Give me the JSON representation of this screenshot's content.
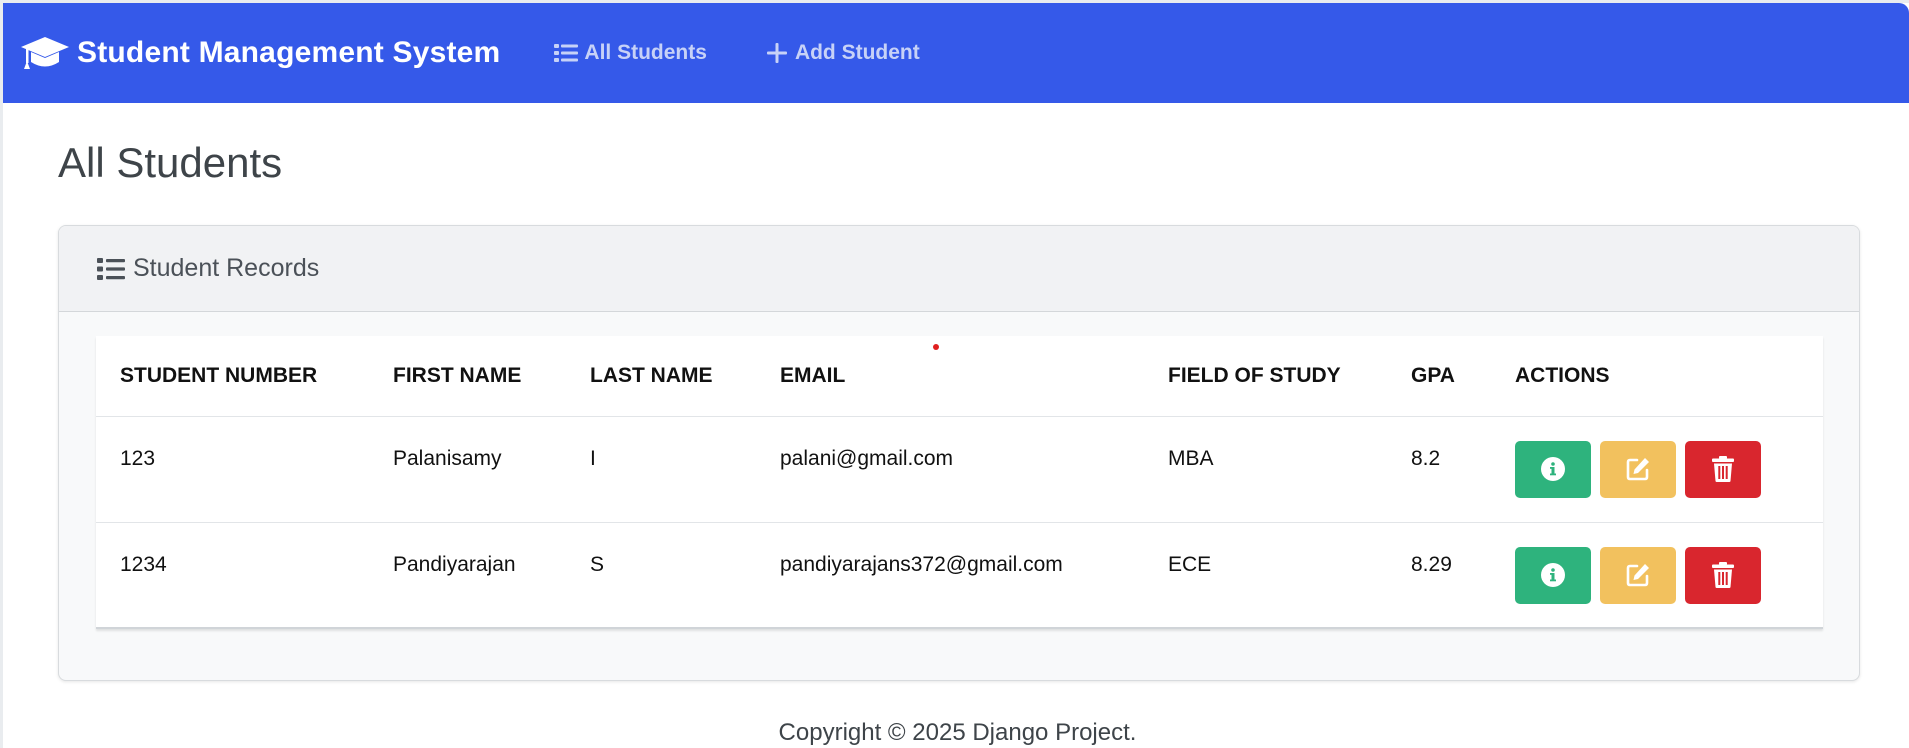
{
  "navbar": {
    "brand_icon": "graduation-cap-icon",
    "brand": "Student Management System",
    "links": [
      {
        "icon": "list-icon",
        "label": "All Students"
      },
      {
        "icon": "plus-icon",
        "label": "Add Student"
      }
    ],
    "bg_color": "#3559e9"
  },
  "page": {
    "title": "All Students"
  },
  "card": {
    "header_icon": "list-icon",
    "header": "Student Records"
  },
  "table": {
    "columns": [
      "Student Number",
      "First Name",
      "Last Name",
      "Email",
      "Field of Study",
      "GPA",
      "Actions"
    ],
    "rows": [
      {
        "student_number": "123",
        "first_name": "Palanisamy",
        "last_name": "I",
        "email": "palani@gmail.com",
        "field_of_study": "MBA",
        "gpa": "8.2",
        "actions": [
          "info-icon",
          "edit-icon",
          "trash-icon"
        ]
      },
      {
        "student_number": "1234",
        "first_name": "Pandiyarajan",
        "last_name": "S",
        "email": "pandiyarajans372@gmail.com",
        "field_of_study": "ECE",
        "gpa": "8.29",
        "actions": [
          "info-icon",
          "edit-icon",
          "trash-icon"
        ]
      }
    ],
    "action_colors": {
      "info": "#2eb37d",
      "edit": "#f2c15e",
      "delete": "#d9262e"
    }
  },
  "footer": {
    "text": "Copyright © 2025 Django Project."
  }
}
